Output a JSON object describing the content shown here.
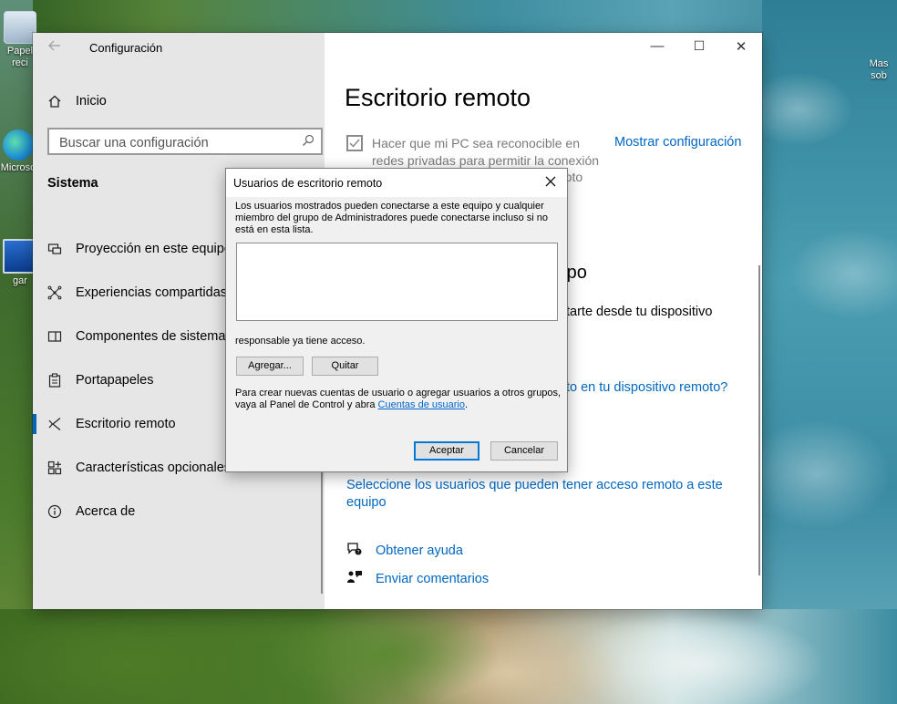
{
  "desktop": {
    "icons": [
      {
        "label": "Papel\nreci",
        "icon": "recycle-bin-icon"
      },
      {
        "label": "Microso",
        "icon": "edge-icon"
      },
      {
        "label": "gar",
        "icon": "computer-icon"
      },
      {
        "label": "Mas\nsob",
        "icon": "desktop-shortcut-icon"
      }
    ]
  },
  "window": {
    "title": "Configuración",
    "controls": {
      "minimize": "—",
      "maximize": "☐",
      "close": "✕"
    }
  },
  "sidebar": {
    "home_label": "Inicio",
    "search_placeholder": "Buscar una configuración",
    "section_heading": "Sistema",
    "items": [
      {
        "label": "Proyección en este equipo",
        "icon": "projection-icon",
        "active": false
      },
      {
        "label": "Experiencias compartidas",
        "icon": "shared-experiences-icon",
        "active": false
      },
      {
        "label": "Componentes de sistema",
        "icon": "system-components-icon",
        "active": false
      },
      {
        "label": "Portapapeles",
        "icon": "clipboard-icon",
        "active": false
      },
      {
        "label": "Escritorio remoto",
        "icon": "remote-desktop-icon",
        "active": true
      },
      {
        "label": "Características opcionales",
        "icon": "optional-features-icon",
        "active": false
      },
      {
        "label": "Acerca de",
        "icon": "info-icon",
        "active": false
      }
    ]
  },
  "content": {
    "page_title": "Escritorio remoto",
    "discoverable_checkbox": {
      "checked": true,
      "text": "Hacer que mi PC sea reconocible en redes privadas para permitir la conexión",
      "text_tail": "moto"
    },
    "show_settings_link": "Mostrar configuración",
    "fragment_heading": "uipo",
    "fragment_text": "tarte desde tu dispositivo",
    "fragment_link": "to en tu dispositivo remoto?",
    "select_users_link": "Seleccione los usuarios que pueden tener acceso remoto a este equipo",
    "help_links": [
      {
        "label": "Obtener ayuda",
        "icon": "help-chat-icon"
      },
      {
        "label": "Enviar comentarios",
        "icon": "feedback-icon"
      }
    ]
  },
  "dialog": {
    "title": "Usuarios de escritorio remoto",
    "description": "Los usuarios mostrados pueden conectarse a este equipo y cualquier miembro del grupo de Administradores puede conectarse incluso si no está en esta lista.",
    "users": [],
    "access_note": "responsable ya tiene acceso.",
    "add_label": "Agregar...",
    "remove_label": "Quitar",
    "help_text": "Para crear nuevas cuentas de usuario o agregar usuarios a otros grupos, vaya al Panel de Control y abra ",
    "help_link": "Cuentas de usuario",
    "help_end": ".",
    "ok_label": "Aceptar",
    "cancel_label": "Cancelar"
  },
  "colors": {
    "accent": "#0067c0",
    "sidebar_bg": "#e6e6e6",
    "dialog_bg": "#f0f0f0"
  }
}
